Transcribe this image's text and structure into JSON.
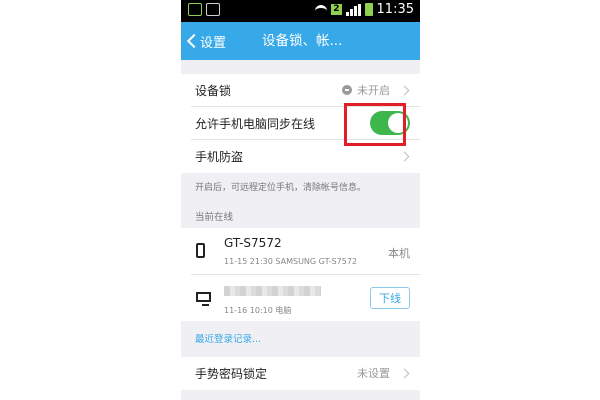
{
  "status_bar": {
    "sim_badge": "2",
    "time": "11:35"
  },
  "app_bar": {
    "back_label": "设置",
    "title": "设备锁、帐..."
  },
  "settings": {
    "device_lock": {
      "label": "设备锁",
      "status": "未开启"
    },
    "allow_sync": {
      "label": "允许手机电脑同步在线",
      "enabled": true
    },
    "anti_theft": {
      "label": "手机防盗"
    }
  },
  "hint_text": "开启后，可远程定位手机，清除帐号信息。",
  "online_section": {
    "label": "当前在线",
    "devices": [
      {
        "name": "GT-S7572",
        "meta": "11-15 21:30 SAMSUNG GT-S7572",
        "tag": "本机",
        "icon": "phone-icon"
      },
      {
        "name": "",
        "meta": "11-16 10:10 电脑",
        "action": "下线",
        "icon": "desktop-icon"
      }
    ]
  },
  "recent_login_link": "最近登录记录...",
  "gesture_lock": {
    "label": "手势密码锁定",
    "status": "未设置"
  }
}
